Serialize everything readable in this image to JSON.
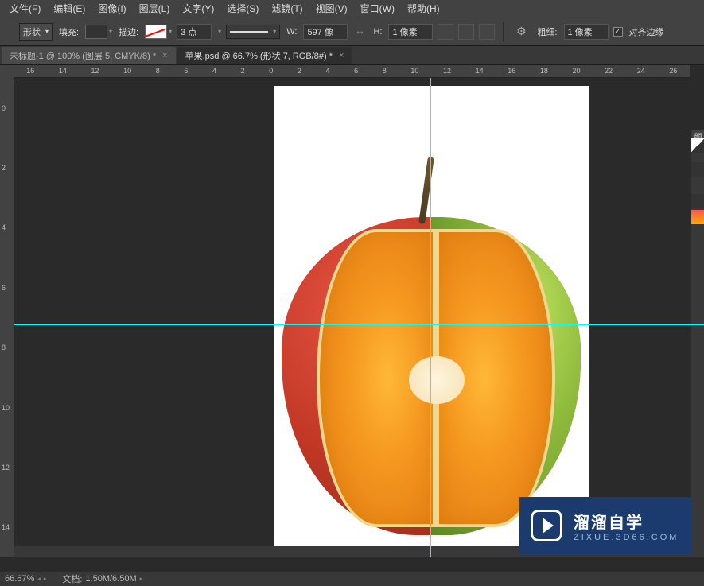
{
  "menubar": {
    "items": [
      "文件(F)",
      "编辑(E)",
      "图像(I)",
      "图层(L)",
      "文字(Y)",
      "选择(S)",
      "滤镜(T)",
      "视图(V)",
      "窗口(W)",
      "帮助(H)"
    ]
  },
  "optionsbar": {
    "tool_mode": "形状",
    "fill_label": "填充:",
    "stroke_label": "描边:",
    "stroke_width": "3 点",
    "width_label": "W:",
    "width_value": "597 像",
    "height_label": "H:",
    "height_value": "1 像素",
    "thickness_label": "粗细:",
    "thickness_value": "1 像素",
    "align_label": "对齐边缘",
    "align_checked": "✓"
  },
  "tabs": [
    {
      "label": "未标题-1 @ 100% (图层 5, CMYK/8) *",
      "active": false
    },
    {
      "label": "苹果.psd @ 66.7% (形状 7, RGB/8#) *",
      "active": true
    }
  ],
  "ruler_h": [
    "16",
    "14",
    "12",
    "10",
    "8",
    "6",
    "4",
    "2",
    "0",
    "2",
    "4",
    "6",
    "8",
    "10",
    "12",
    "14",
    "16",
    "18",
    "20",
    "22",
    "24",
    "26"
  ],
  "ruler_v": [
    "0",
    "2",
    "4",
    "6",
    "8",
    "10",
    "12",
    "14"
  ],
  "statusbar": {
    "zoom": "66.67%",
    "doc_label": "文档:",
    "doc_size": "1.50M/6.50M"
  },
  "right_panel": {
    "label": "颜"
  },
  "watermark": {
    "title": "溜溜自学",
    "url": "ZIXUE.3D66.COM"
  }
}
